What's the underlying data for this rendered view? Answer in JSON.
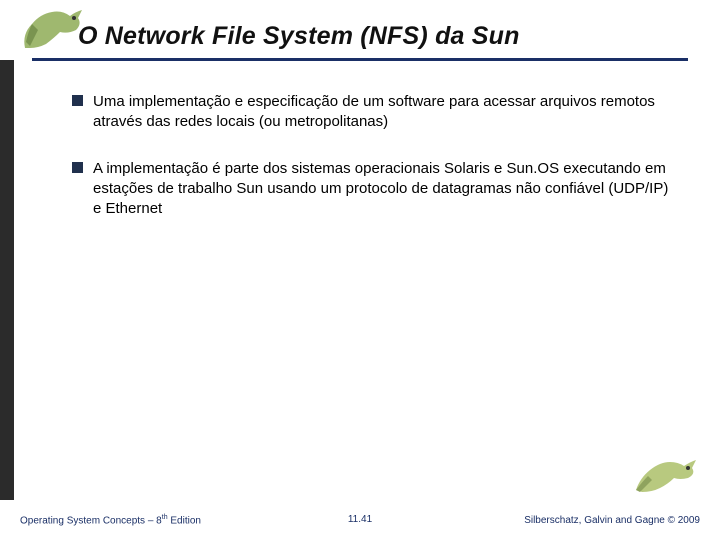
{
  "title": "O Network File System (NFS) da Sun",
  "bullets": [
    "Uma implementação e especificação de um software para acessar arquivos remotos através das redes locais (ou metropolitanas)",
    "A implementação é parte dos sistemas operacionais Solaris e Sun.OS executando em estações de trabalho Sun usando um protocolo de datagramas não confiável (UDP/IP) e Ethernet"
  ],
  "footer": {
    "left_prefix": "Operating System Concepts – 8",
    "left_sup": "th",
    "left_suffix": " Edition",
    "center": "11.41",
    "right": "Silberschatz, Galvin and Gagne © 2009"
  }
}
